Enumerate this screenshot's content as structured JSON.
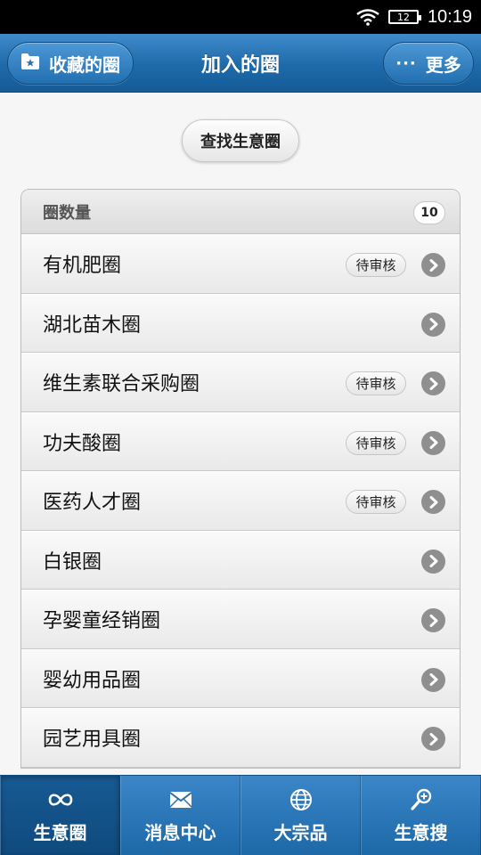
{
  "status_bar": {
    "time": "10:19",
    "battery": "12"
  },
  "header": {
    "left_button": "收藏的圈",
    "title": "加入的圈",
    "right_button_dots": "···",
    "right_button": "更多"
  },
  "find_button": "查找生意圈",
  "list": {
    "header_label": "圈数量",
    "count": "10",
    "items": [
      {
        "name": "有机肥圈",
        "badge": "待审核"
      },
      {
        "name": "湖北苗木圈",
        "badge": ""
      },
      {
        "name": "维生素联合采购圈",
        "badge": "待审核"
      },
      {
        "name": "功夫酸圈",
        "badge": "待审核"
      },
      {
        "name": "医药人才圈",
        "badge": "待审核"
      },
      {
        "name": "白银圈",
        "badge": ""
      },
      {
        "name": "孕婴童经销圈",
        "badge": ""
      },
      {
        "name": "婴幼用品圈",
        "badge": ""
      },
      {
        "name": "园艺用具圈",
        "badge": ""
      }
    ]
  },
  "tabbar": [
    {
      "label": "生意圈",
      "icon": "infinity-icon",
      "active": true
    },
    {
      "label": "消息中心",
      "icon": "envelope-icon",
      "active": false
    },
    {
      "label": "大宗品",
      "icon": "globe-icon",
      "active": false
    },
    {
      "label": "生意搜",
      "icon": "search-icon",
      "active": false
    }
  ]
}
